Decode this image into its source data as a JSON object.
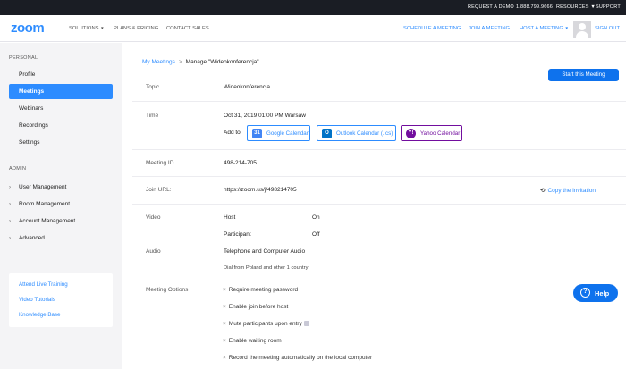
{
  "topbar": {
    "request_demo": "REQUEST A DEMO",
    "phone": "1.888.799.9666",
    "resources": "RESOURCES",
    "support": "SUPPORT"
  },
  "nav": {
    "logo": "zoom",
    "solutions": "SOLUTIONS",
    "plans": "PLANS & PRICING",
    "contact": "CONTACT SALES",
    "schedule": "SCHEDULE A MEETING",
    "join": "JOIN A MEETING",
    "host": "HOST A MEETING",
    "sign_out": "SIGN OUT"
  },
  "sidebar": {
    "personal_title": "PERSONAL",
    "personal_items": [
      "Profile",
      "Meetings",
      "Webinars",
      "Recordings",
      "Settings"
    ],
    "admin_title": "ADMIN",
    "admin_items": [
      "User Management",
      "Room Management",
      "Account Management",
      "Advanced"
    ],
    "links": [
      "Attend Live Training",
      "Video Tutorials",
      "Knowledge Base"
    ]
  },
  "breadcrumb": {
    "parent": "My Meetings",
    "separator": ">",
    "current": "Manage \"Wideokonferencja\""
  },
  "start_button": "Start this Meeting",
  "meeting": {
    "topic_label": "Topic",
    "topic": "Wideokonferencja",
    "time_label": "Time",
    "time": "Oct 31, 2019 01:00 PM Warsaw",
    "add_to": "Add to",
    "calendars": [
      "Google Calendar",
      "Outlook Calendar (.ics)",
      "Yahoo Calendar"
    ],
    "id_label": "Meeting ID",
    "id": "498-214-705",
    "join_label": "Join URL:",
    "join_url": "https://zoom.us/j/498214705",
    "copy_invite": "Copy the invitation",
    "video_label": "Video",
    "host_label": "Host",
    "host_value": "On",
    "participant_label": "Participant",
    "participant_value": "Off",
    "audio_label": "Audio",
    "audio_value": "Telephone and Computer Audio",
    "dial_pre": "Dial from",
    "dial_country": "Poland",
    "dial_post": "and other 1 country",
    "options_label": "Meeting Options",
    "options": [
      "Require meeting password",
      "Enable join before host",
      "Mute participants upon entry",
      "Enable waiting room",
      "Record the meeting automatically on the local computer"
    ]
  },
  "help_button": "Help",
  "colors": {
    "brand": "#2d8cff",
    "button": "#0e72ed",
    "topbar": "#1a1d24",
    "outlook": "#0072c6",
    "yahoo": "#720e9e"
  }
}
